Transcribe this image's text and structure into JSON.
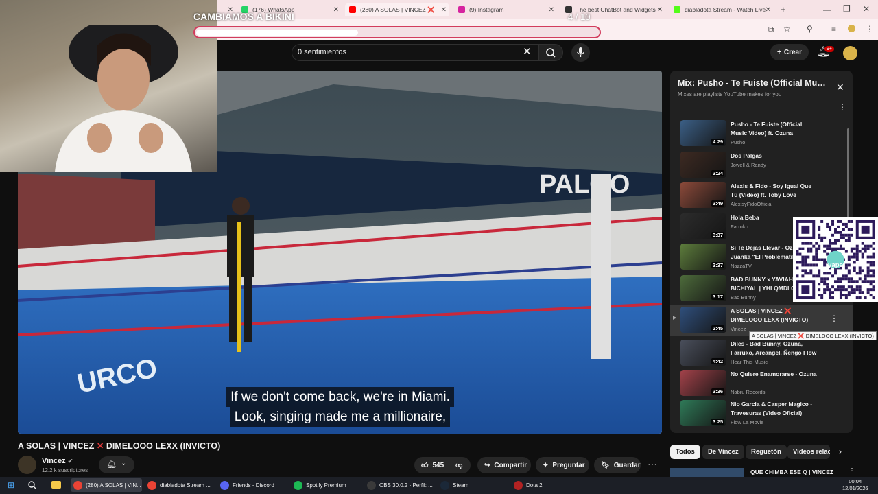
{
  "browser": {
    "tabs": [
      {
        "label": "",
        "color": "#888888"
      },
      {
        "label": "(176) WhatsApp",
        "color": "#25d366"
      },
      {
        "label": "(280) A SOLAS | VINCEZ ❌",
        "color": "#ff0000"
      },
      {
        "label": "(9) Instagram",
        "color": "#d6249f"
      },
      {
        "label": "The best ChatBot and Widgets",
        "color": "#333333"
      },
      {
        "label": "diabladota Stream - Watch Live",
        "color": "#53fc18"
      }
    ],
    "address_partial": "..."
  },
  "overlay": {
    "stream_title": "CAMBIAMOS A BIKINI",
    "counter": "4 / 10",
    "progress": 0.4
  },
  "youtube": {
    "search_value": "0 sentimientos",
    "create_label": "Crear",
    "notif_badge": "9+",
    "subtitle_line1": "If we don't come back, we're in Miami.",
    "subtitle_line2": "Look, singing made me a millionaire,",
    "video_title_part1": "A SOLAS | VINCEZ",
    "video_title_part2": "DIMELOOO LEXX (INVICTO)",
    "channel": {
      "name": "Vincez",
      "subs": "12.2 k suscriptores"
    },
    "actions": {
      "likes": "545",
      "share": "Compartir",
      "ask": "Preguntar",
      "save": "Guardar"
    },
    "tooltip": "A SOLAS | VINCEZ ❌ DIMELOOO LEXX (INVICTO)"
  },
  "playlist": {
    "title": "Mix: Pusho - Te Fuiste (Official Music Video) ft. Ozuna",
    "subtitle": "Mixes are playlists YouTube makes for you",
    "items": [
      {
        "title": "Pusho - Te Fuiste (Official Music Video) ft. Ozuna",
        "channel": "Pusho",
        "duration": "4:29",
        "color": "#3b5f86"
      },
      {
        "title": "Dos Palgas",
        "channel": "Jowell & Randy",
        "duration": "3:24",
        "color": "#3d2a22"
      },
      {
        "title": "Alexis & Fido - Soy Igual Que Tú (Video) ft. Toby Love",
        "channel": "AlexisyFidoOfficial",
        "duration": "3:49",
        "color": "#8c4a3a"
      },
      {
        "title": "Hola Beba",
        "channel": "Farruko",
        "duration": "3:37",
        "color": "#2c2c2c"
      },
      {
        "title": "Si Te Dejas Llevar - Ozuna, Juanka \"El Problematik\"",
        "channel": "NazzaTV",
        "duration": "3:37",
        "color": "#5d7d3c"
      },
      {
        "title": "BAD BUNNY x YAVIAH - BICHIYAL | YHLQMDLG",
        "channel": "Bad Bunny",
        "duration": "3:17",
        "color": "#4d6b3b"
      },
      {
        "title": "A SOLAS | VINCEZ ❌ DIMELOOO LEXX (INVICTO)",
        "channel": "Vincez",
        "duration": "2:45",
        "color": "#2f4f7c"
      },
      {
        "title": "Diles - Bad Bunny, Ozuna, Farruko, Arcangel, Ñengo Flow",
        "channel": "Hear This Music",
        "duration": "4:42",
        "color": "#4a4f5c"
      },
      {
        "title": "No Quiere Enamorarse - Ozuna",
        "channel": "Nabru Records",
        "duration": "3:36",
        "color": "#a3424a"
      },
      {
        "title": "Nio Garcia & Casper Magico - Travesuras (Video Oficial)",
        "channel": "Flow La Movie",
        "duration": "3:25",
        "color": "#2f7a58"
      }
    ]
  },
  "chips": [
    "Todos",
    "De Vincez",
    "Reguetón",
    "Videos relac"
  ],
  "recommendation": "QUE CHIMBA ESE Q | VINCEZ",
  "qr_label": "yape",
  "taskbar": {
    "items": [
      {
        "label": "(280) A SOLAS | VIN...",
        "color": "#ea4335"
      },
      {
        "label": "diabladota Stream ...",
        "color": "#ea4335"
      },
      {
        "label": "Friends - Discord",
        "color": "#5865f2"
      },
      {
        "label": "Spotify Premium",
        "color": "#1db954"
      },
      {
        "label": "OBS 30.0.2 - Perfil: ...",
        "color": "#3a3a3a"
      },
      {
        "label": "Steam",
        "color": "#1b2838"
      },
      {
        "label": "Dota 2",
        "color": "#b22222"
      }
    ],
    "time": "00:04",
    "date": "12/01/2026"
  }
}
